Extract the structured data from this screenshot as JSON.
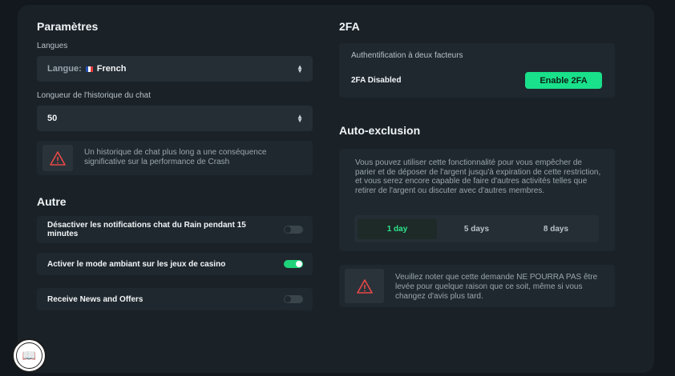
{
  "settings": {
    "title": "Paramètres",
    "language_label": "Langues",
    "language_prefix": "Langue:",
    "language_value": "French",
    "history_label": "Longueur de l'historique du chat",
    "history_value": "50",
    "warning_text": "Un historique de chat plus long a une conséquence significative sur la performance de Crash"
  },
  "other": {
    "title": "Autre",
    "toggles": [
      {
        "label": "Désactiver les notifications chat du Rain pendant 15 minutes",
        "on": false
      },
      {
        "label": "Activer le mode ambiant sur les jeux de casino",
        "on": true
      },
      {
        "label": "Receive News and Offers",
        "on": false
      }
    ]
  },
  "twofa": {
    "title": "2FA",
    "subtitle": "Authentification à deux facteurs",
    "status": "2FA Disabled",
    "enable_button": "Enable 2FA"
  },
  "self_exclusion": {
    "title": "Auto-exclusion",
    "description": "Vous pouvez utiliser cette fonctionnalité pour vous empêcher de parier et de déposer de l'argent jusqu'à expiration de cette restriction, et vous serez encore capable de faire d'autres activités telles que retirer de l'argent ou discuter avec d'autres membres.",
    "options": [
      "1 day",
      "5 days",
      "8 days"
    ],
    "selected_option": "1 day",
    "warning_text": "Veuillez noter que cette demande NE POURRA PAS être levée pour quelque raison que ce soit, même si vous changez d'avis plus tard."
  },
  "colors": {
    "accent": "#19e08a",
    "warning": "#e74848",
    "background": "#12181d",
    "panel": "#1a2228"
  },
  "icons": {
    "warning": "warning-triangle-icon",
    "select_arrows": "chevron-up-down-icon",
    "badge": "book-seal-icon"
  }
}
